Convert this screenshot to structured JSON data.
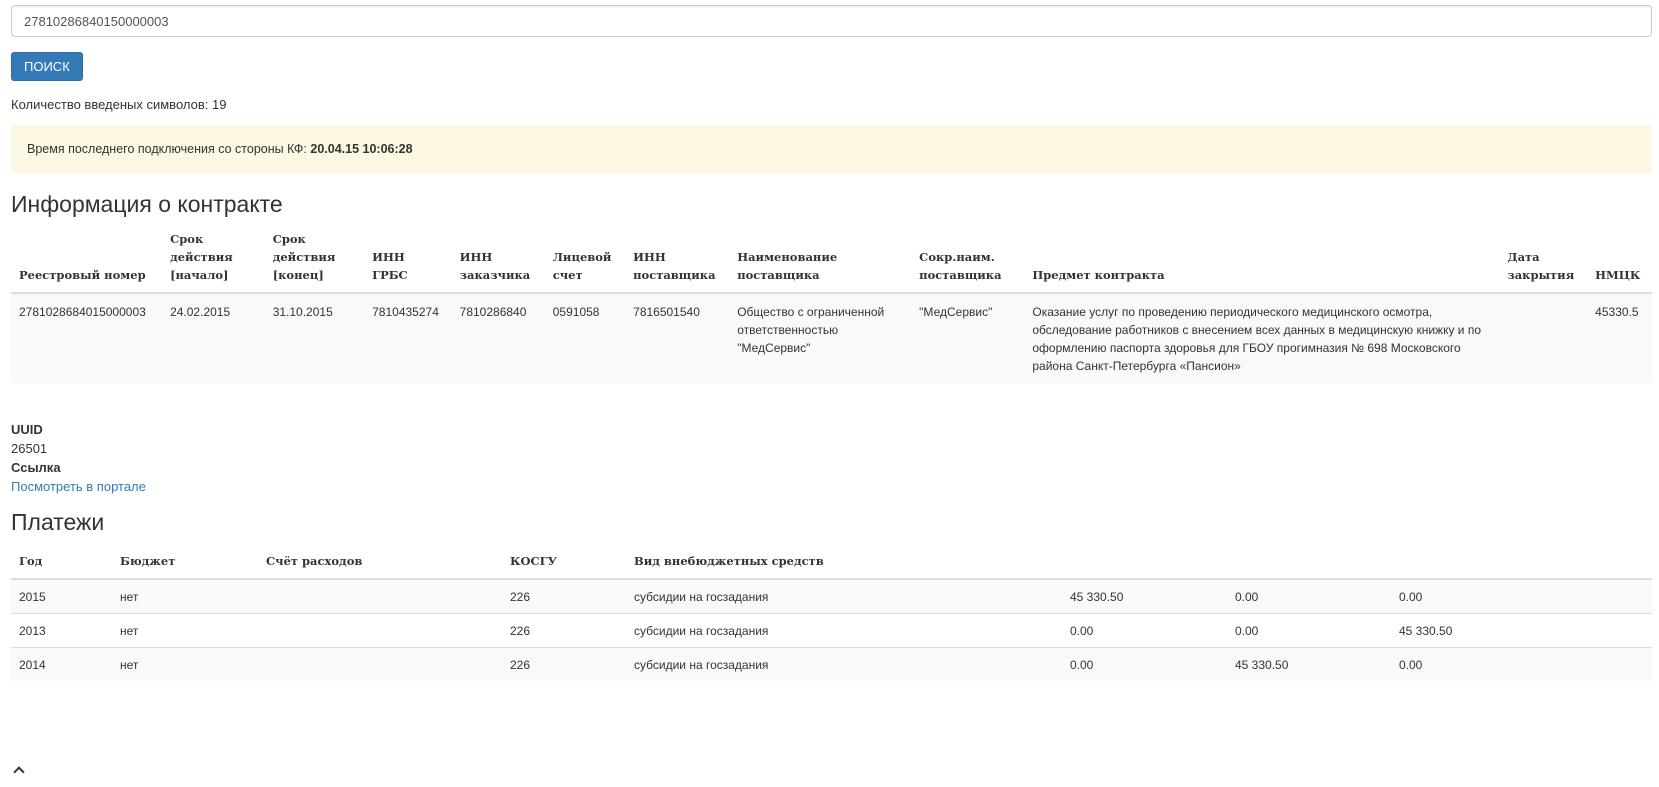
{
  "search": {
    "value": "27810286840150000003",
    "button_label": "ПОИСК",
    "char_count": "Количество введеных символов: 19"
  },
  "alert": {
    "label": "Время последнего подключения со стороны КФ: ",
    "value": "20.04.15 10:06:28"
  },
  "contract": {
    "title": "Информация о контракте",
    "headers": [
      "Реестровый номер",
      "Срок действия [начало]",
      "Срок действия [конец]",
      "ИНН ГРБС",
      "ИНН заказчика",
      "Лицевой счет",
      "ИНН поставщика",
      "Наименование поставщика",
      "Сокр.наим. поставщика",
      "Предмет контракта",
      "Дата закрытия",
      "НМЦК"
    ],
    "row": [
      "2781028684015000003",
      "24.02.2015",
      "31.10.2015",
      "7810435274",
      "7810286840",
      "0591058",
      "7816501540",
      "Общество с ограниченной ответственностью \"МедСервис\"",
      "\"МедСервис\"",
      "Оказание услуг по проведению периодического медицинского осмотра, обследование работников с внесением всех данных в медицинскую книжку и по оформлению паспорта здоровья для ГБОУ прогимназия № 698 Московского района Санкт-Петербурга «Пансион»",
      "",
      "45330.5"
    ]
  },
  "meta": {
    "uuid_label": "UUID",
    "uuid_value": "26501",
    "link_label": "Ссылка",
    "link_text": "Посмотреть в портале"
  },
  "payments": {
    "title": "Платежи",
    "headers": [
      "Год",
      "Бюджет",
      "Счёт расходов",
      "КОСГУ",
      "Вид внебюджетных средств",
      "",
      "",
      ""
    ],
    "rows": [
      [
        "2015",
        "нет",
        "",
        "226",
        "субсидии на госзадания",
        "45 330.50",
        "0.00",
        "0.00"
      ],
      [
        "2013",
        "нет",
        "",
        "226",
        "субсидии на госзадания",
        "0.00",
        "0.00",
        "45 330.50"
      ],
      [
        "2014",
        "нет",
        "",
        "226",
        "субсидии на госзадания",
        "0.00",
        "45 330.50",
        "0.00"
      ]
    ]
  },
  "icons": {
    "bottom": "chevron-up-icon"
  }
}
